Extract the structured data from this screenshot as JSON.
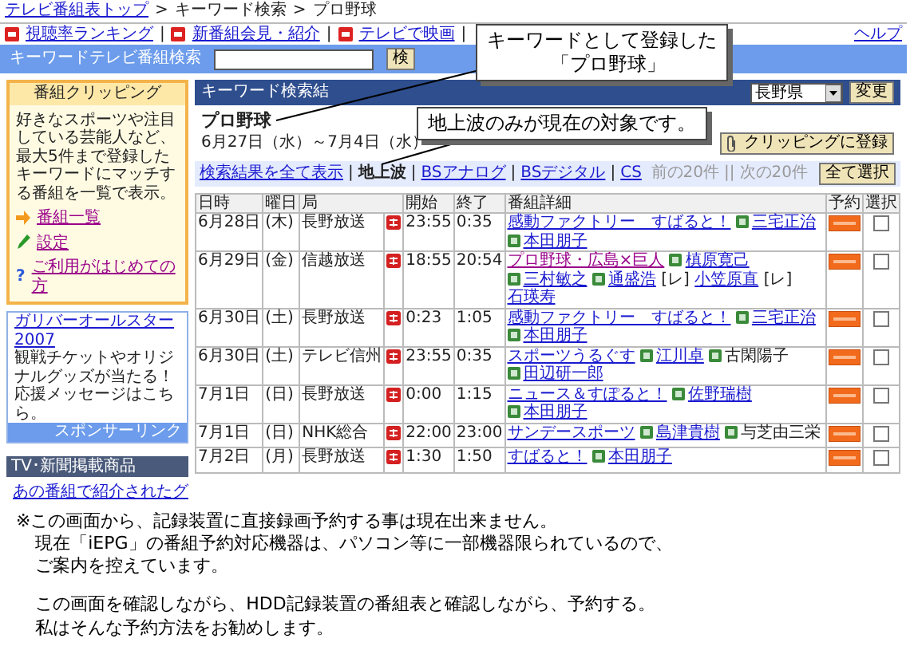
{
  "breadcrumb": [
    {
      "kind": "link",
      "text": "テレビ番組表トップ"
    },
    {
      "kind": "sep",
      "text": ">"
    },
    {
      "kind": "text",
      "text": "キーワード検索"
    },
    {
      "kind": "sep",
      "text": ">"
    },
    {
      "kind": "text",
      "text": "プロ野球"
    }
  ],
  "top_links": [
    {
      "kind": "link",
      "text": "視聴率ランキング"
    },
    {
      "kind": "sep",
      "text": "|"
    },
    {
      "kind": "link",
      "text": "新番組会見・紹介"
    },
    {
      "kind": "sep",
      "text": "|"
    },
    {
      "kind": "link",
      "text": "テレビで映画"
    },
    {
      "kind": "sep",
      "text": "|"
    }
  ],
  "help_link": "ヘルプ",
  "search": {
    "label": "キーワードテレビ番組検索",
    "button": "検"
  },
  "sidebar": {
    "clipping": {
      "title": "番組クリッピング",
      "text": "好きなスポーツや注目している芸能人など、最大5件まで登録したキーワードにマッチする番組を一覧で表示。",
      "links": [
        {
          "kind": "arrow",
          "text": "番組一覧"
        },
        {
          "kind": "pencil",
          "text": "設定"
        },
        {
          "kind": "help",
          "mark": "?",
          "text": "ご利用がはじめての方"
        }
      ]
    },
    "ad": {
      "title": "ガリバーオールスター2007",
      "text": "観戦チケットやオリジナルグッズが当たる！応援メッセージはこちら。",
      "footer": "スポンサーリンク"
    },
    "products": {
      "title": "TV･新聞掲載商品",
      "link": "あの番組で紹介されたグ"
    }
  },
  "results": {
    "title": "キーワード検索結",
    "region_select": "長野県",
    "change_button": "変更",
    "keyword": "プロ野球",
    "date_range": "6月27日（水）～7月4日（水）",
    "clip_button": "クリッピングに登録"
  },
  "filters": [
    {
      "text": "検索結果を全て表示",
      "selected": false
    },
    {
      "text": "地上波",
      "selected": true
    },
    {
      "text": "BSアナログ",
      "selected": false
    },
    {
      "text": "BSデジタル",
      "selected": false
    },
    {
      "text": "CS",
      "selected": false
    }
  ],
  "filter_separator": "|",
  "pager": {
    "prev": "前の20件",
    "separator": "||",
    "next": "次の20件",
    "disabled": true
  },
  "select_all_button": "全て選択",
  "table": {
    "columns": [
      "日時",
      "曜日",
      "局",
      "開始",
      "終了",
      "番組詳細",
      "予約",
      "選択"
    ],
    "rows": [
      {
        "date": "6月28日",
        "day": "(木)",
        "station": "長野放送",
        "start": "23:55",
        "end": "0:35",
        "title": "感動ファクトリー　すばると！",
        "visited": false,
        "cast": [
          {
            "name": "三宅正治",
            "icon": true,
            "linked": true
          },
          {
            "name": "本田朋子",
            "icon": true,
            "linked": true
          }
        ],
        "checked": false
      },
      {
        "date": "6月29日",
        "day": "(金)",
        "station": "信越放送",
        "start": "18:55",
        "end": "20:54",
        "title": "プロ野球・広島×巨人",
        "visited": true,
        "cast": [
          {
            "name": "槙原寛己",
            "icon": true,
            "linked": true
          },
          {
            "name": "三村敏之",
            "icon": true,
            "linked": true
          },
          {
            "name": "通盛浩",
            "icon": true,
            "linked": true
          },
          {
            "name": "[レ]",
            "icon": false,
            "linked": false
          },
          {
            "name": "小笠原直",
            "icon": false,
            "linked": true
          },
          {
            "name": "[レ]",
            "icon": false,
            "linked": false
          },
          {
            "name": "石瑛寿",
            "icon": false,
            "linked": true
          }
        ],
        "checked": false
      },
      {
        "date": "6月30日",
        "day": "(土)",
        "station": "長野放送",
        "start": "0:23",
        "end": "1:05",
        "title": "感動ファクトリー　すばると！",
        "visited": false,
        "cast": [
          {
            "name": "三宅正治",
            "icon": true,
            "linked": true
          },
          {
            "name": "本田朋子",
            "icon": true,
            "linked": true
          }
        ],
        "checked": false
      },
      {
        "date": "6月30日",
        "day": "(土)",
        "station": "テレビ信州",
        "start": "23:55",
        "end": "0:35",
        "title": "スポーツうるぐす",
        "visited": false,
        "cast": [
          {
            "name": "江川卓",
            "icon": true,
            "linked": true
          },
          {
            "name": "古閑陽子",
            "icon": true,
            "linked": false
          },
          {
            "name": "田辺研一郎",
            "icon": true,
            "linked": true
          }
        ],
        "checked": false
      },
      {
        "date": "7月1日",
        "day": "(日)",
        "station": "長野放送",
        "start": "0:00",
        "end": "1:15",
        "title": "ニュース＆すぽると！",
        "visited": false,
        "cast": [
          {
            "name": "佐野瑞樹",
            "icon": true,
            "linked": true
          },
          {
            "name": "本田朋子",
            "icon": true,
            "linked": true
          }
        ],
        "checked": false
      },
      {
        "date": "7月1日",
        "day": "(日)",
        "station": "NHK総合",
        "start": "22:00",
        "end": "23:00",
        "title": "サンデースポーツ",
        "visited": false,
        "cast": [
          {
            "name": "島津貴樹",
            "icon": true,
            "linked": true
          },
          {
            "name": "与芝由三栄",
            "icon": true,
            "linked": false
          }
        ],
        "checked": false
      },
      {
        "date": "7月2日",
        "day": "(月)",
        "station": "長野放送",
        "start": "1:30",
        "end": "1:50",
        "title": "すばると！",
        "visited": false,
        "cast": [
          {
            "name": "本田朋子",
            "icon": true,
            "linked": true
          }
        ],
        "checked": false
      }
    ]
  },
  "callouts": [
    {
      "lines": [
        "キーワードとして登録した",
        "「プロ野球」"
      ]
    },
    {
      "lines": [
        "地上波のみが現在の対象です。"
      ]
    }
  ],
  "note": {
    "paragraphs": [
      [
        "※この画面から、記録装置に直接録画予約する事は現在出来ません。",
        "現在「iEPG」の番組予約対応機器は、パソコン等に一部機器限られているので、",
        "ご案内を控えています。"
      ],
      [
        "この画面を確認しながら、HDD記録装置の番組表と確認しながら、予約する。",
        "私はそんな予約方法をお勧めします。"
      ]
    ]
  }
}
